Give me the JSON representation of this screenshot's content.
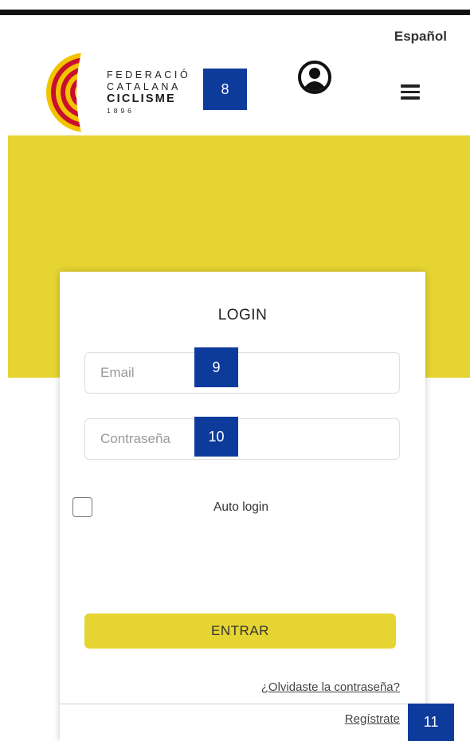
{
  "header": {
    "language": "Español",
    "logo": {
      "line1": "FEDERACIÓ",
      "line2": "CATALANA",
      "line3": "CICLISME",
      "year": "1896"
    },
    "user_icon": "user-circle-icon",
    "menu_icon": "hamburger-menu-icon"
  },
  "badges": {
    "b8": "8",
    "b9": "9",
    "b10": "10",
    "b11": "11"
  },
  "login": {
    "title": "LOGIN",
    "email_placeholder": "Email",
    "email_value": "",
    "password_placeholder": "Contraseña",
    "password_value": "",
    "auto_login_label": "Auto login",
    "auto_login_checked": false,
    "submit_label": "ENTRAR",
    "forgot_label": "¿Olvidaste la contraseña?",
    "register_label": "Regístrate"
  },
  "colors": {
    "accent_yellow": "#e6d432",
    "badge_blue": "#0d3b9c",
    "logo_red": "#c8102e",
    "logo_yellow": "#f2c400"
  }
}
